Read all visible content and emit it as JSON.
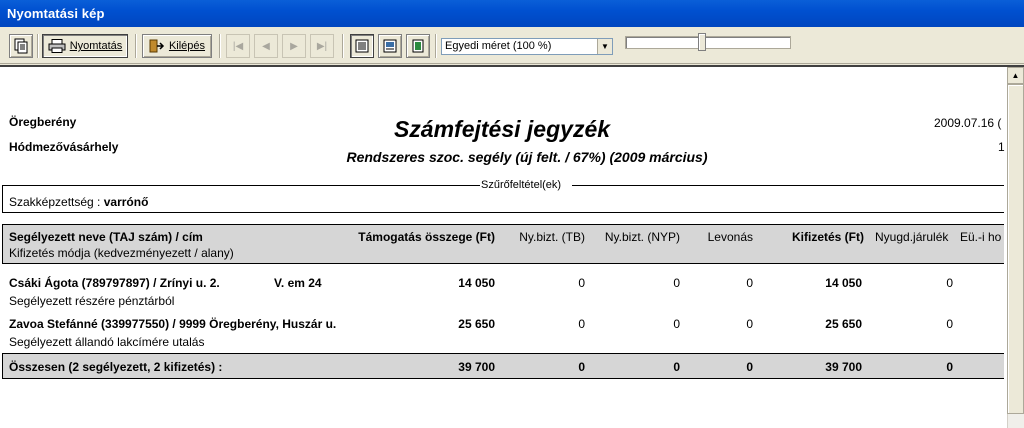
{
  "window": {
    "title": "Nyomtatási kép"
  },
  "toolbar": {
    "print_label": "Nyomtatás",
    "exit_label": "Kilépés",
    "zoom": {
      "selected": "Egyedi méret (100 %)"
    },
    "zoom_slider_level_percent": 46
  },
  "report": {
    "org_line1": "Öregberény",
    "org_line2": "Hódmezővásárhely",
    "title": "Számfejtési jegyzék",
    "subtitle": "Rendszeres szoc. segély (új felt. / 67%) (2009 március)",
    "date": "2009.07.16 (",
    "page_no": "1",
    "filter_caption": "Szűrőfeltétel(ek)",
    "filter_label": "Szakképzettség : ",
    "filter_value": "varrónő",
    "columns": {
      "name": "Segélyezett neve (TAJ szám) / cím",
      "payment_mode": "Kifizetés módja (kedvezményezett / alany)",
      "support": "Támogatás összege (Ft)",
      "tb": "Ny.bizt. (TB)",
      "nyp": "Ny.bizt. (NYP)",
      "deduction": "Levonás",
      "payout": "Kifizetés (Ft)",
      "pension": "Nyugd.járulék",
      "health": "Eü.-i ho"
    },
    "rows": [
      {
        "name": "Csáki Ágota (789797897) / Zrínyi u. 2.",
        "extra": "V. em  24",
        "mode": "Segélyezett részére pénztárból",
        "support": "14 050",
        "tb": "0",
        "nyp": "0",
        "deduction": "0",
        "payout": "14 050",
        "pension": "0"
      },
      {
        "name": "Zavoa Stefánné (339977550) / 9999 Öregberény, Huszár u.",
        "extra": "",
        "mode": "Segélyezett állandó lakcímére utalás",
        "support": "25 650",
        "tb": "0",
        "nyp": "0",
        "deduction": "0",
        "payout": "25 650",
        "pension": "0"
      }
    ],
    "total": {
      "label": "Összesen (2 segélyezett, 2 kifizetés) :",
      "support": "39 700",
      "tb": "0",
      "nyp": "0",
      "deduction": "0",
      "payout": "39 700",
      "pension": "0"
    }
  }
}
